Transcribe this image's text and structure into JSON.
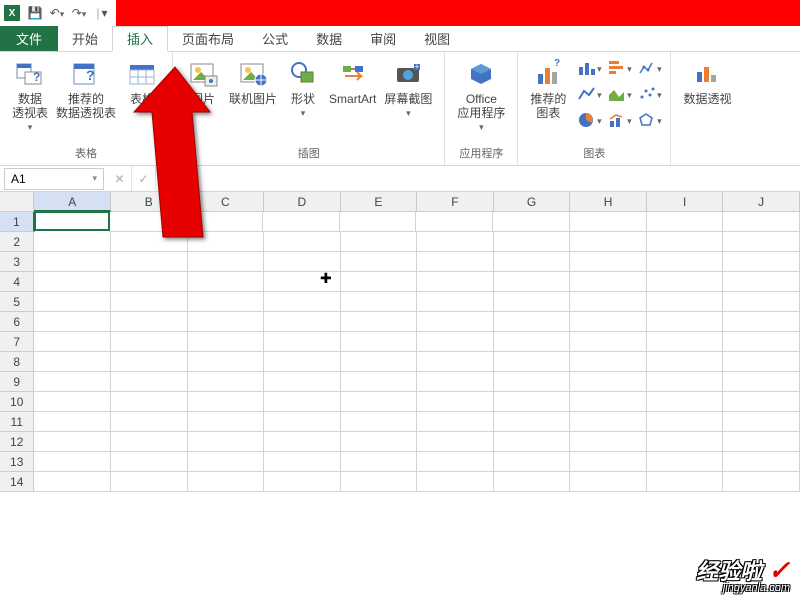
{
  "qat": {
    "save": "💾",
    "undo": "↶",
    "redo": "↷"
  },
  "tabs": {
    "file": "文件",
    "items": [
      "开始",
      "插入",
      "页面布局",
      "公式",
      "数据",
      "审阅",
      "视图"
    ],
    "active_index": 1
  },
  "ribbon": {
    "groups": {
      "tables": {
        "label": "表格",
        "pivot": "数据\n透视表",
        "rec_pivot": "推荐的\n数据透视表",
        "table": "表格"
      },
      "illustrations": {
        "label": "插图",
        "picture": "图片",
        "online_pic": "联机图片",
        "shapes": "形状",
        "smartart": "SmartArt",
        "screenshot": "屏幕截图"
      },
      "apps": {
        "label": "应用程序",
        "office_apps": "Office\n应用程序"
      },
      "charts": {
        "label": "图表",
        "rec_charts": "推荐的\n图表",
        "pivot_chart": "数据透视"
      }
    }
  },
  "namebox": "A1",
  "columns": [
    "A",
    "B",
    "C",
    "D",
    "E",
    "F",
    "G",
    "H",
    "I",
    "J"
  ],
  "rows": [
    "1",
    "2",
    "3",
    "4",
    "5",
    "6",
    "7",
    "8",
    "9",
    "10",
    "11",
    "12",
    "13",
    "14"
  ],
  "active_cell": {
    "row": 0,
    "col": 0
  },
  "watermark": {
    "main": "经验啦",
    "sub": "jingyanla.com"
  }
}
